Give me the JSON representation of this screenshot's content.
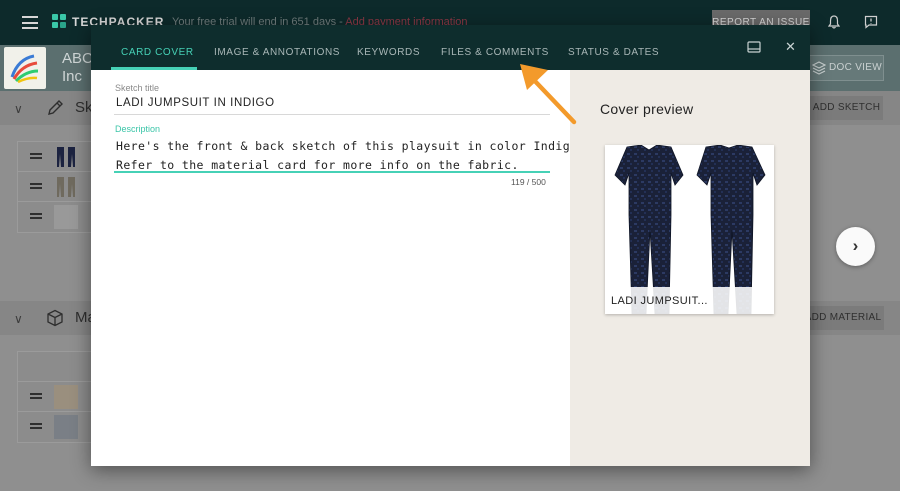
{
  "app": {
    "brand": "TECHPACKER",
    "trial_text": "Your free trial will end in 651 days -",
    "trial_link": "Add payment information",
    "report_label": "REPORT AN ISSUE",
    "company_line1": "ABC",
    "company_line2": "Inc",
    "doc_view_label": "DOC VIEW"
  },
  "sections": {
    "sketch_title": "Sk",
    "add_sketch_label": "ADD SKETCH",
    "material_title": "Ma",
    "add_material_label": "ADD MATERIAL"
  },
  "modal": {
    "tabs": [
      {
        "label": "CARD COVER",
        "active": true
      },
      {
        "label": "IMAGE & ANNOTATIONS",
        "active": false
      },
      {
        "label": "KEYWORDS",
        "active": false
      },
      {
        "label": "FILES & COMMENTS",
        "active": false
      },
      {
        "label": "STATUS & DATES",
        "active": false
      }
    ],
    "sketch_title_label": "Sketch title",
    "sketch_title_value": "LADI JUMPSUIT IN INDIGO",
    "description_label": "Description",
    "description_line1": "Here's the front & back sketch of this playsuit in color Indigo",
    "description_line2": "Refer to the material card for more info on the fabric.",
    "char_count": "119 / 500",
    "preview_title": "Cover preview",
    "cover_caption": "LADI JUMPSUIT..."
  },
  "colors": {
    "accent": "#46d1b6",
    "modal_header": "#0e2d2d",
    "preview_bg": "#efebe5",
    "arrow": "#f39a2b",
    "garment": "#1c2340"
  },
  "icons": [
    "menu-icon",
    "techpacker-logo",
    "bell-icon",
    "feedback-icon",
    "layout-icon",
    "close-icon",
    "pencil-icon",
    "cube-icon",
    "chevron-right-icon",
    "drag-handle-icon"
  ]
}
